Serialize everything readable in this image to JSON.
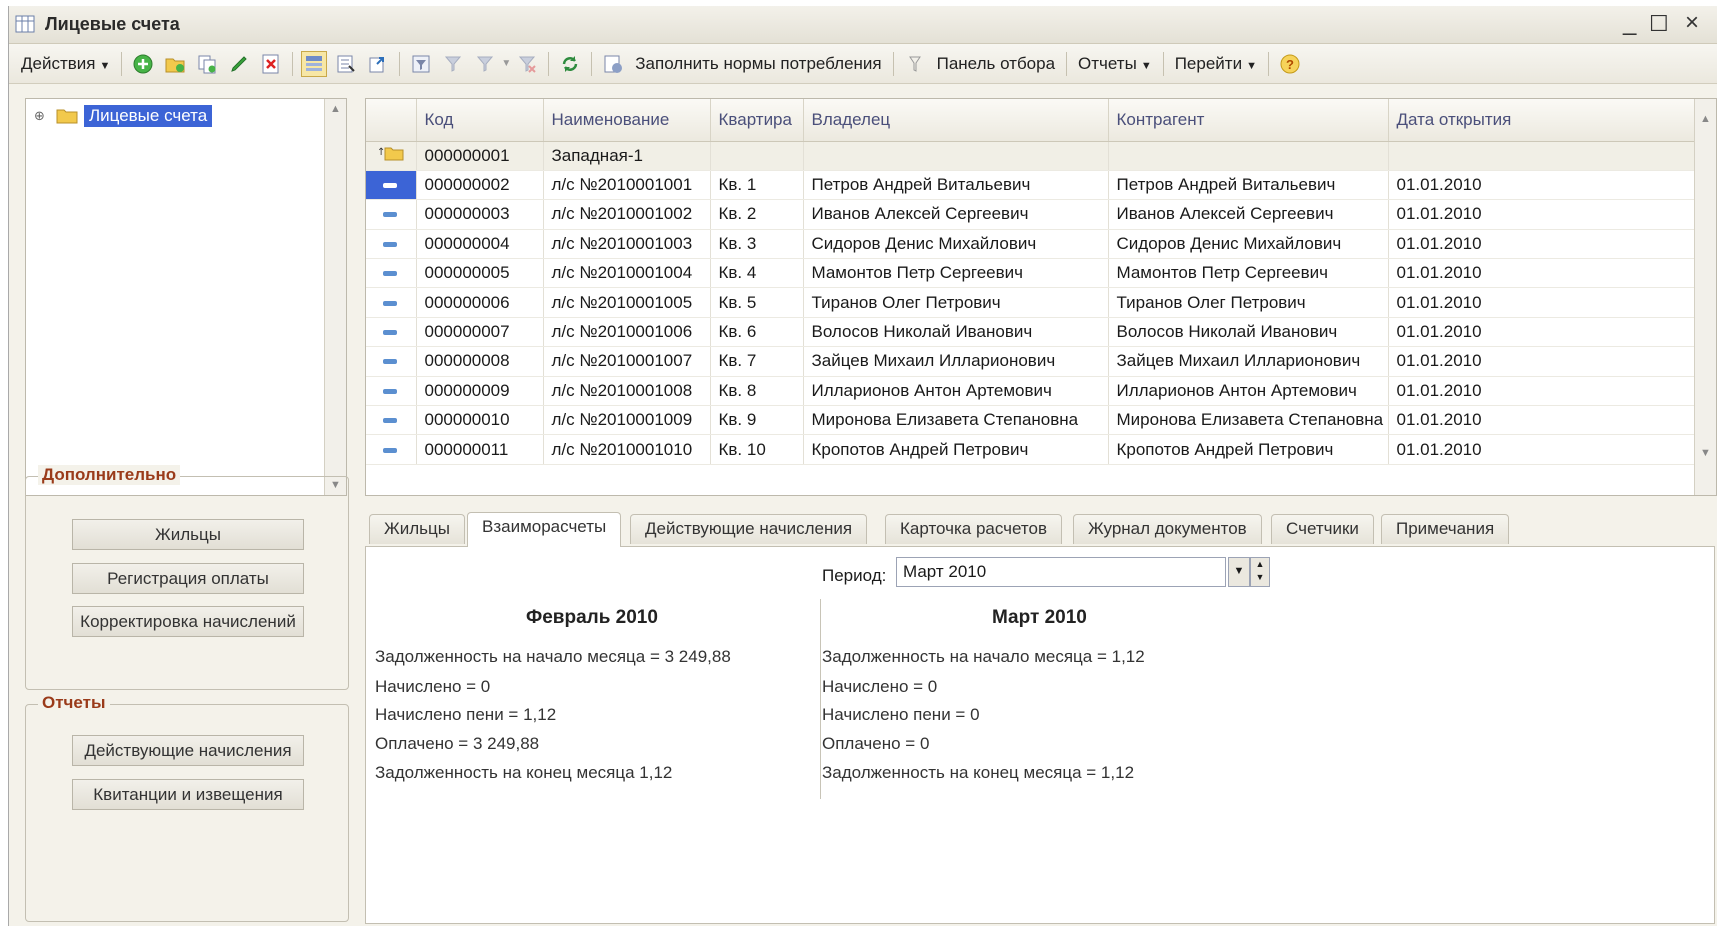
{
  "window": {
    "title": "Лицевые счета"
  },
  "toolbar": {
    "actions_label": "Действия",
    "fill_norms_label": "Заполнить нормы потребления",
    "filter_panel_label": "Панель отбора",
    "reports_label": "Отчеты",
    "goto_label": "Перейти"
  },
  "tree": {
    "root_label": "Лицевые счета"
  },
  "grid": {
    "columns": [
      "Код",
      "Наименование",
      "Квартира",
      "Владелец",
      "Контрагент",
      "Дата открытия"
    ],
    "group_row": {
      "code": "000000001",
      "name": "Западная-1"
    },
    "rows": [
      {
        "code": "000000002",
        "name": "л/с №2010001001",
        "flat": "Кв. 1",
        "owner": "Петров Андрей Витальевич",
        "contractor": "Петров Андрей Витальевич",
        "date": "01.01.2010"
      },
      {
        "code": "000000003",
        "name": "л/с №2010001002",
        "flat": "Кв. 2",
        "owner": "Иванов Алексей Сергеевич",
        "contractor": "Иванов Алексей Сергеевич",
        "date": "01.01.2010"
      },
      {
        "code": "000000004",
        "name": "л/с №2010001003",
        "flat": "Кв. 3",
        "owner": "Сидоров Денис Михайлович",
        "contractor": "Сидоров Денис Михайлович",
        "date": "01.01.2010"
      },
      {
        "code": "000000005",
        "name": "л/с №2010001004",
        "flat": "Кв. 4",
        "owner": "Мамонтов Петр Сергеевич",
        "contractor": "Мамонтов Петр Сергеевич",
        "date": "01.01.2010"
      },
      {
        "code": "000000006",
        "name": "л/с №2010001005",
        "flat": "Кв. 5",
        "owner": "Тиранов Олег Петрович",
        "contractor": "Тиранов Олег Петрович",
        "date": "01.01.2010"
      },
      {
        "code": "000000007",
        "name": "л/с №2010001006",
        "flat": "Кв. 6",
        "owner": "Волосов Николай Иванович",
        "contractor": "Волосов Николай Иванович",
        "date": "01.01.2010"
      },
      {
        "code": "000000008",
        "name": "л/с №2010001007",
        "flat": "Кв. 7",
        "owner": "Зайцев Михаил Илларионович",
        "contractor": "Зайцев Михаил Илларионович",
        "date": "01.01.2010"
      },
      {
        "code": "000000009",
        "name": "л/с №2010001008",
        "flat": "Кв. 8",
        "owner": "Илларионов Антон Артемович",
        "contractor": "Илларионов Антон Артемович",
        "date": "01.01.2010"
      },
      {
        "code": "000000010",
        "name": "л/с №2010001009",
        "flat": "Кв. 9",
        "owner": "Миронова Елизавета Степановна",
        "contractor": "Миронова Елизавета Степановна",
        "date": "01.01.2010"
      },
      {
        "code": "000000011",
        "name": "л/с №2010001010",
        "flat": "Кв. 10",
        "owner": "Кропотов Андрей Петрович",
        "contractor": "Кропотов Андрей Петрович",
        "date": "01.01.2010"
      }
    ]
  },
  "extra": {
    "title": "Дополнительно",
    "buttons": [
      "Жильцы",
      "Регистрация оплаты",
      "Корректировка начислений"
    ]
  },
  "reports": {
    "title": "Отчеты",
    "buttons": [
      "Действующие начисления",
      "Квитанции и извещения"
    ]
  },
  "tabs": [
    "Жильцы",
    "Взаиморасчеты",
    "Действующие начисления",
    "Карточка расчетов",
    "Журнал документов",
    "Счетчики",
    "Примечания"
  ],
  "settlement": {
    "period_label": "Период:",
    "period_value": "Март 2010",
    "left": {
      "title": "Февраль 2010",
      "lines": [
        "Задолженность на начало месяца = 3 249,88",
        "Начислено = 0",
        "Начислено пени = 1,12",
        "Оплачено = 3 249,88",
        "Задолженность на конец месяца 1,12"
      ]
    },
    "right": {
      "title": "Март 2010",
      "lines": [
        "Задолженность на начало месяца = 1,12",
        "Начислено = 0",
        "Начислено пени = 0",
        "Оплачено = 0",
        "Задолженность на конец месяца = 1,12"
      ]
    }
  },
  "colors": {
    "selection": "#3c64d6",
    "group_title": "#9a3b1a",
    "accent_icon": "#3aa43a"
  }
}
